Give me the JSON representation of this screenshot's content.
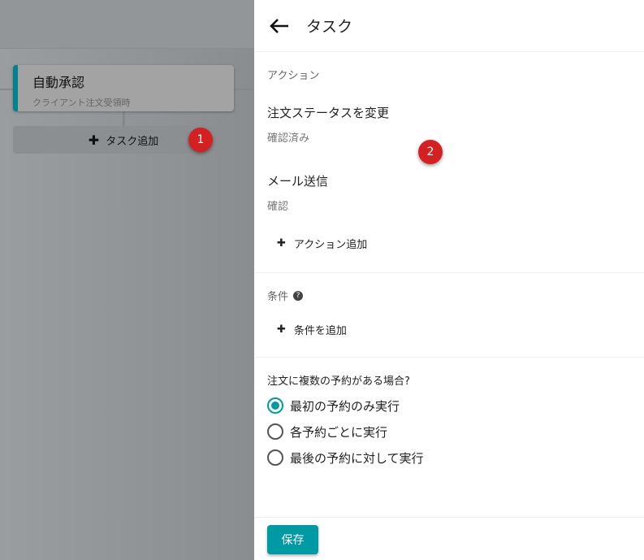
{
  "left": {
    "card": {
      "title": "自動承認",
      "subtitle": "クライアント注文受領時"
    },
    "add_task": "タスク追加",
    "badge1": "1"
  },
  "panel": {
    "title": "タスク",
    "badge2": "2",
    "actions": {
      "label": "アクション",
      "items": [
        {
          "title": "注文ステータスを変更",
          "sub": "確認済み"
        },
        {
          "title": "メール送信",
          "sub": "確認"
        }
      ],
      "add": "アクション追加"
    },
    "conditions": {
      "label": "条件",
      "add": "条件を追加"
    },
    "multi": {
      "question": "注文に複数の予約がある場合?",
      "options": [
        "最初の予約のみ実行",
        "各予約ごとに実行",
        "最後の予約に対して実行"
      ],
      "selected": 0
    },
    "save": "保存"
  },
  "colors": {
    "accent": "#009aa5",
    "badge": "#d42020"
  }
}
